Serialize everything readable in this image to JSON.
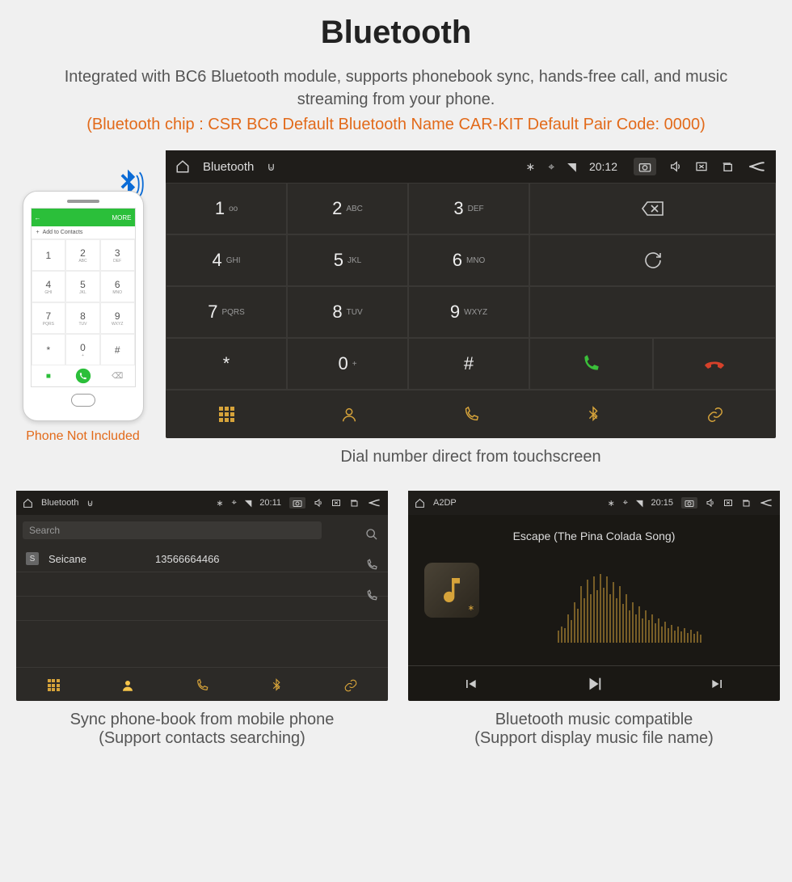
{
  "header": {
    "title": "Bluetooth",
    "subtitle": "Integrated with BC6 Bluetooth module, supports phonebook sync, hands-free call, and music streaming from your phone.",
    "spec_line": "(Bluetooth chip : CSR BC6     Default Bluetooth Name CAR-KIT     Default Pair Code: 0000)"
  },
  "phone": {
    "add_contacts": "Add to Contacts",
    "more": "MORE",
    "caption": "Phone Not Included",
    "keys": [
      {
        "n": "1",
        "s": ""
      },
      {
        "n": "2",
        "s": "ABC"
      },
      {
        "n": "3",
        "s": "DEF"
      },
      {
        "n": "4",
        "s": "GHI"
      },
      {
        "n": "5",
        "s": "JKL"
      },
      {
        "n": "6",
        "s": "MNO"
      },
      {
        "n": "7",
        "s": "PQRS"
      },
      {
        "n": "8",
        "s": "TUV"
      },
      {
        "n": "9",
        "s": "WXYZ"
      },
      {
        "n": "*",
        "s": ""
      },
      {
        "n": "0",
        "s": "+"
      },
      {
        "n": "#",
        "s": ""
      }
    ]
  },
  "dialer": {
    "topbar_title": "Bluetooth",
    "clock": "20:12",
    "keys": [
      {
        "n": "1",
        "s": "oo"
      },
      {
        "n": "2",
        "s": "ABC"
      },
      {
        "n": "3",
        "s": "DEF"
      },
      {
        "n": "4",
        "s": "GHI"
      },
      {
        "n": "5",
        "s": "JKL"
      },
      {
        "n": "6",
        "s": "MNO"
      },
      {
        "n": "7",
        "s": "PQRS"
      },
      {
        "n": "8",
        "s": "TUV"
      },
      {
        "n": "9",
        "s": "WXYZ"
      },
      {
        "n": "*",
        "s": ""
      },
      {
        "n": "0",
        "s": "+"
      },
      {
        "n": "#",
        "s": ""
      }
    ],
    "caption": "Dial number direct from touchscreen"
  },
  "contacts": {
    "topbar_title": "Bluetooth",
    "clock": "20:11",
    "search_placeholder": "Search",
    "contact_badge": "S",
    "contact_name": "Seicane",
    "contact_number": "13566664466",
    "caption_l1": "Sync phone-book from mobile phone",
    "caption_l2": "(Support contacts searching)"
  },
  "music": {
    "topbar_title": "A2DP",
    "clock": "20:15",
    "track": "Escape (The Pina Colada Song)",
    "caption_l1": "Bluetooth music compatible",
    "caption_l2": "(Support display music file name)"
  },
  "icons": {
    "home": "home-icon",
    "usb": "usb-icon",
    "bluetooth": "bluetooth-icon",
    "location": "location-icon",
    "wifi": "wifi-icon",
    "camera": "camera-icon",
    "volume": "volume-icon",
    "close": "close-icon",
    "recent": "recent-apps-icon",
    "back": "back-icon",
    "backspace": "backspace-icon",
    "redial": "redial-icon",
    "call": "call-icon",
    "hangup": "hangup-icon",
    "keypad": "keypad-icon",
    "person": "person-icon",
    "phone": "phone-icon",
    "link": "link-icon",
    "search": "search-icon",
    "prev": "prev-track-icon",
    "play": "play-pause-icon",
    "next": "next-track-icon",
    "plus": "plus-icon"
  },
  "colors": {
    "accent": "#d6a33a",
    "orange": "#e26a1a",
    "call_green": "#3bbf3a",
    "hangup_red": "#d6412a"
  }
}
